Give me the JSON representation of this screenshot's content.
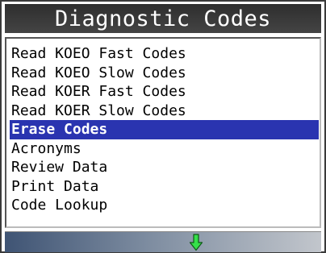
{
  "title": "Diagnostic Codes",
  "menu": {
    "items": [
      {
        "label": "Read KOEO Fast Codes"
      },
      {
        "label": "Read KOEO Slow Codes"
      },
      {
        "label": "Read KOER Fast Codes"
      },
      {
        "label": "Read KOER Slow Codes"
      },
      {
        "label": "Erase Codes"
      },
      {
        "label": "Acronyms"
      },
      {
        "label": "Review Data"
      },
      {
        "label": "Print Data"
      },
      {
        "label": "Code Lookup"
      }
    ],
    "selected_index": 4
  },
  "status_bar": {
    "scroll_icon": "arrow-down-icon",
    "icon_color": "#35e04a"
  },
  "colors": {
    "title_bg": "#333333",
    "selection_bg": "#2a34b0"
  }
}
